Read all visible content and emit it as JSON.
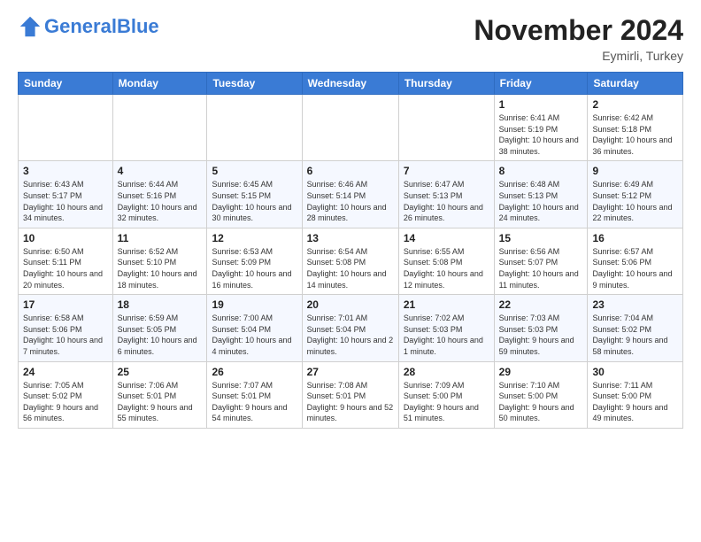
{
  "header": {
    "logo_line1": "General",
    "logo_line2": "Blue",
    "month": "November 2024",
    "location": "Eymirli, Turkey"
  },
  "days_of_week": [
    "Sunday",
    "Monday",
    "Tuesday",
    "Wednesday",
    "Thursday",
    "Friday",
    "Saturday"
  ],
  "weeks": [
    [
      {
        "day": "",
        "info": ""
      },
      {
        "day": "",
        "info": ""
      },
      {
        "day": "",
        "info": ""
      },
      {
        "day": "",
        "info": ""
      },
      {
        "day": "",
        "info": ""
      },
      {
        "day": "1",
        "info": "Sunrise: 6:41 AM\nSunset: 5:19 PM\nDaylight: 10 hours and 38 minutes."
      },
      {
        "day": "2",
        "info": "Sunrise: 6:42 AM\nSunset: 5:18 PM\nDaylight: 10 hours and 36 minutes."
      }
    ],
    [
      {
        "day": "3",
        "info": "Sunrise: 6:43 AM\nSunset: 5:17 PM\nDaylight: 10 hours and 34 minutes."
      },
      {
        "day": "4",
        "info": "Sunrise: 6:44 AM\nSunset: 5:16 PM\nDaylight: 10 hours and 32 minutes."
      },
      {
        "day": "5",
        "info": "Sunrise: 6:45 AM\nSunset: 5:15 PM\nDaylight: 10 hours and 30 minutes."
      },
      {
        "day": "6",
        "info": "Sunrise: 6:46 AM\nSunset: 5:14 PM\nDaylight: 10 hours and 28 minutes."
      },
      {
        "day": "7",
        "info": "Sunrise: 6:47 AM\nSunset: 5:13 PM\nDaylight: 10 hours and 26 minutes."
      },
      {
        "day": "8",
        "info": "Sunrise: 6:48 AM\nSunset: 5:13 PM\nDaylight: 10 hours and 24 minutes."
      },
      {
        "day": "9",
        "info": "Sunrise: 6:49 AM\nSunset: 5:12 PM\nDaylight: 10 hours and 22 minutes."
      }
    ],
    [
      {
        "day": "10",
        "info": "Sunrise: 6:50 AM\nSunset: 5:11 PM\nDaylight: 10 hours and 20 minutes."
      },
      {
        "day": "11",
        "info": "Sunrise: 6:52 AM\nSunset: 5:10 PM\nDaylight: 10 hours and 18 minutes."
      },
      {
        "day": "12",
        "info": "Sunrise: 6:53 AM\nSunset: 5:09 PM\nDaylight: 10 hours and 16 minutes."
      },
      {
        "day": "13",
        "info": "Sunrise: 6:54 AM\nSunset: 5:08 PM\nDaylight: 10 hours and 14 minutes."
      },
      {
        "day": "14",
        "info": "Sunrise: 6:55 AM\nSunset: 5:08 PM\nDaylight: 10 hours and 12 minutes."
      },
      {
        "day": "15",
        "info": "Sunrise: 6:56 AM\nSunset: 5:07 PM\nDaylight: 10 hours and 11 minutes."
      },
      {
        "day": "16",
        "info": "Sunrise: 6:57 AM\nSunset: 5:06 PM\nDaylight: 10 hours and 9 minutes."
      }
    ],
    [
      {
        "day": "17",
        "info": "Sunrise: 6:58 AM\nSunset: 5:06 PM\nDaylight: 10 hours and 7 minutes."
      },
      {
        "day": "18",
        "info": "Sunrise: 6:59 AM\nSunset: 5:05 PM\nDaylight: 10 hours and 6 minutes."
      },
      {
        "day": "19",
        "info": "Sunrise: 7:00 AM\nSunset: 5:04 PM\nDaylight: 10 hours and 4 minutes."
      },
      {
        "day": "20",
        "info": "Sunrise: 7:01 AM\nSunset: 5:04 PM\nDaylight: 10 hours and 2 minutes."
      },
      {
        "day": "21",
        "info": "Sunrise: 7:02 AM\nSunset: 5:03 PM\nDaylight: 10 hours and 1 minute."
      },
      {
        "day": "22",
        "info": "Sunrise: 7:03 AM\nSunset: 5:03 PM\nDaylight: 9 hours and 59 minutes."
      },
      {
        "day": "23",
        "info": "Sunrise: 7:04 AM\nSunset: 5:02 PM\nDaylight: 9 hours and 58 minutes."
      }
    ],
    [
      {
        "day": "24",
        "info": "Sunrise: 7:05 AM\nSunset: 5:02 PM\nDaylight: 9 hours and 56 minutes."
      },
      {
        "day": "25",
        "info": "Sunrise: 7:06 AM\nSunset: 5:01 PM\nDaylight: 9 hours and 55 minutes."
      },
      {
        "day": "26",
        "info": "Sunrise: 7:07 AM\nSunset: 5:01 PM\nDaylight: 9 hours and 54 minutes."
      },
      {
        "day": "27",
        "info": "Sunrise: 7:08 AM\nSunset: 5:01 PM\nDaylight: 9 hours and 52 minutes."
      },
      {
        "day": "28",
        "info": "Sunrise: 7:09 AM\nSunset: 5:00 PM\nDaylight: 9 hours and 51 minutes."
      },
      {
        "day": "29",
        "info": "Sunrise: 7:10 AM\nSunset: 5:00 PM\nDaylight: 9 hours and 50 minutes."
      },
      {
        "day": "30",
        "info": "Sunrise: 7:11 AM\nSunset: 5:00 PM\nDaylight: 9 hours and 49 minutes."
      }
    ]
  ]
}
